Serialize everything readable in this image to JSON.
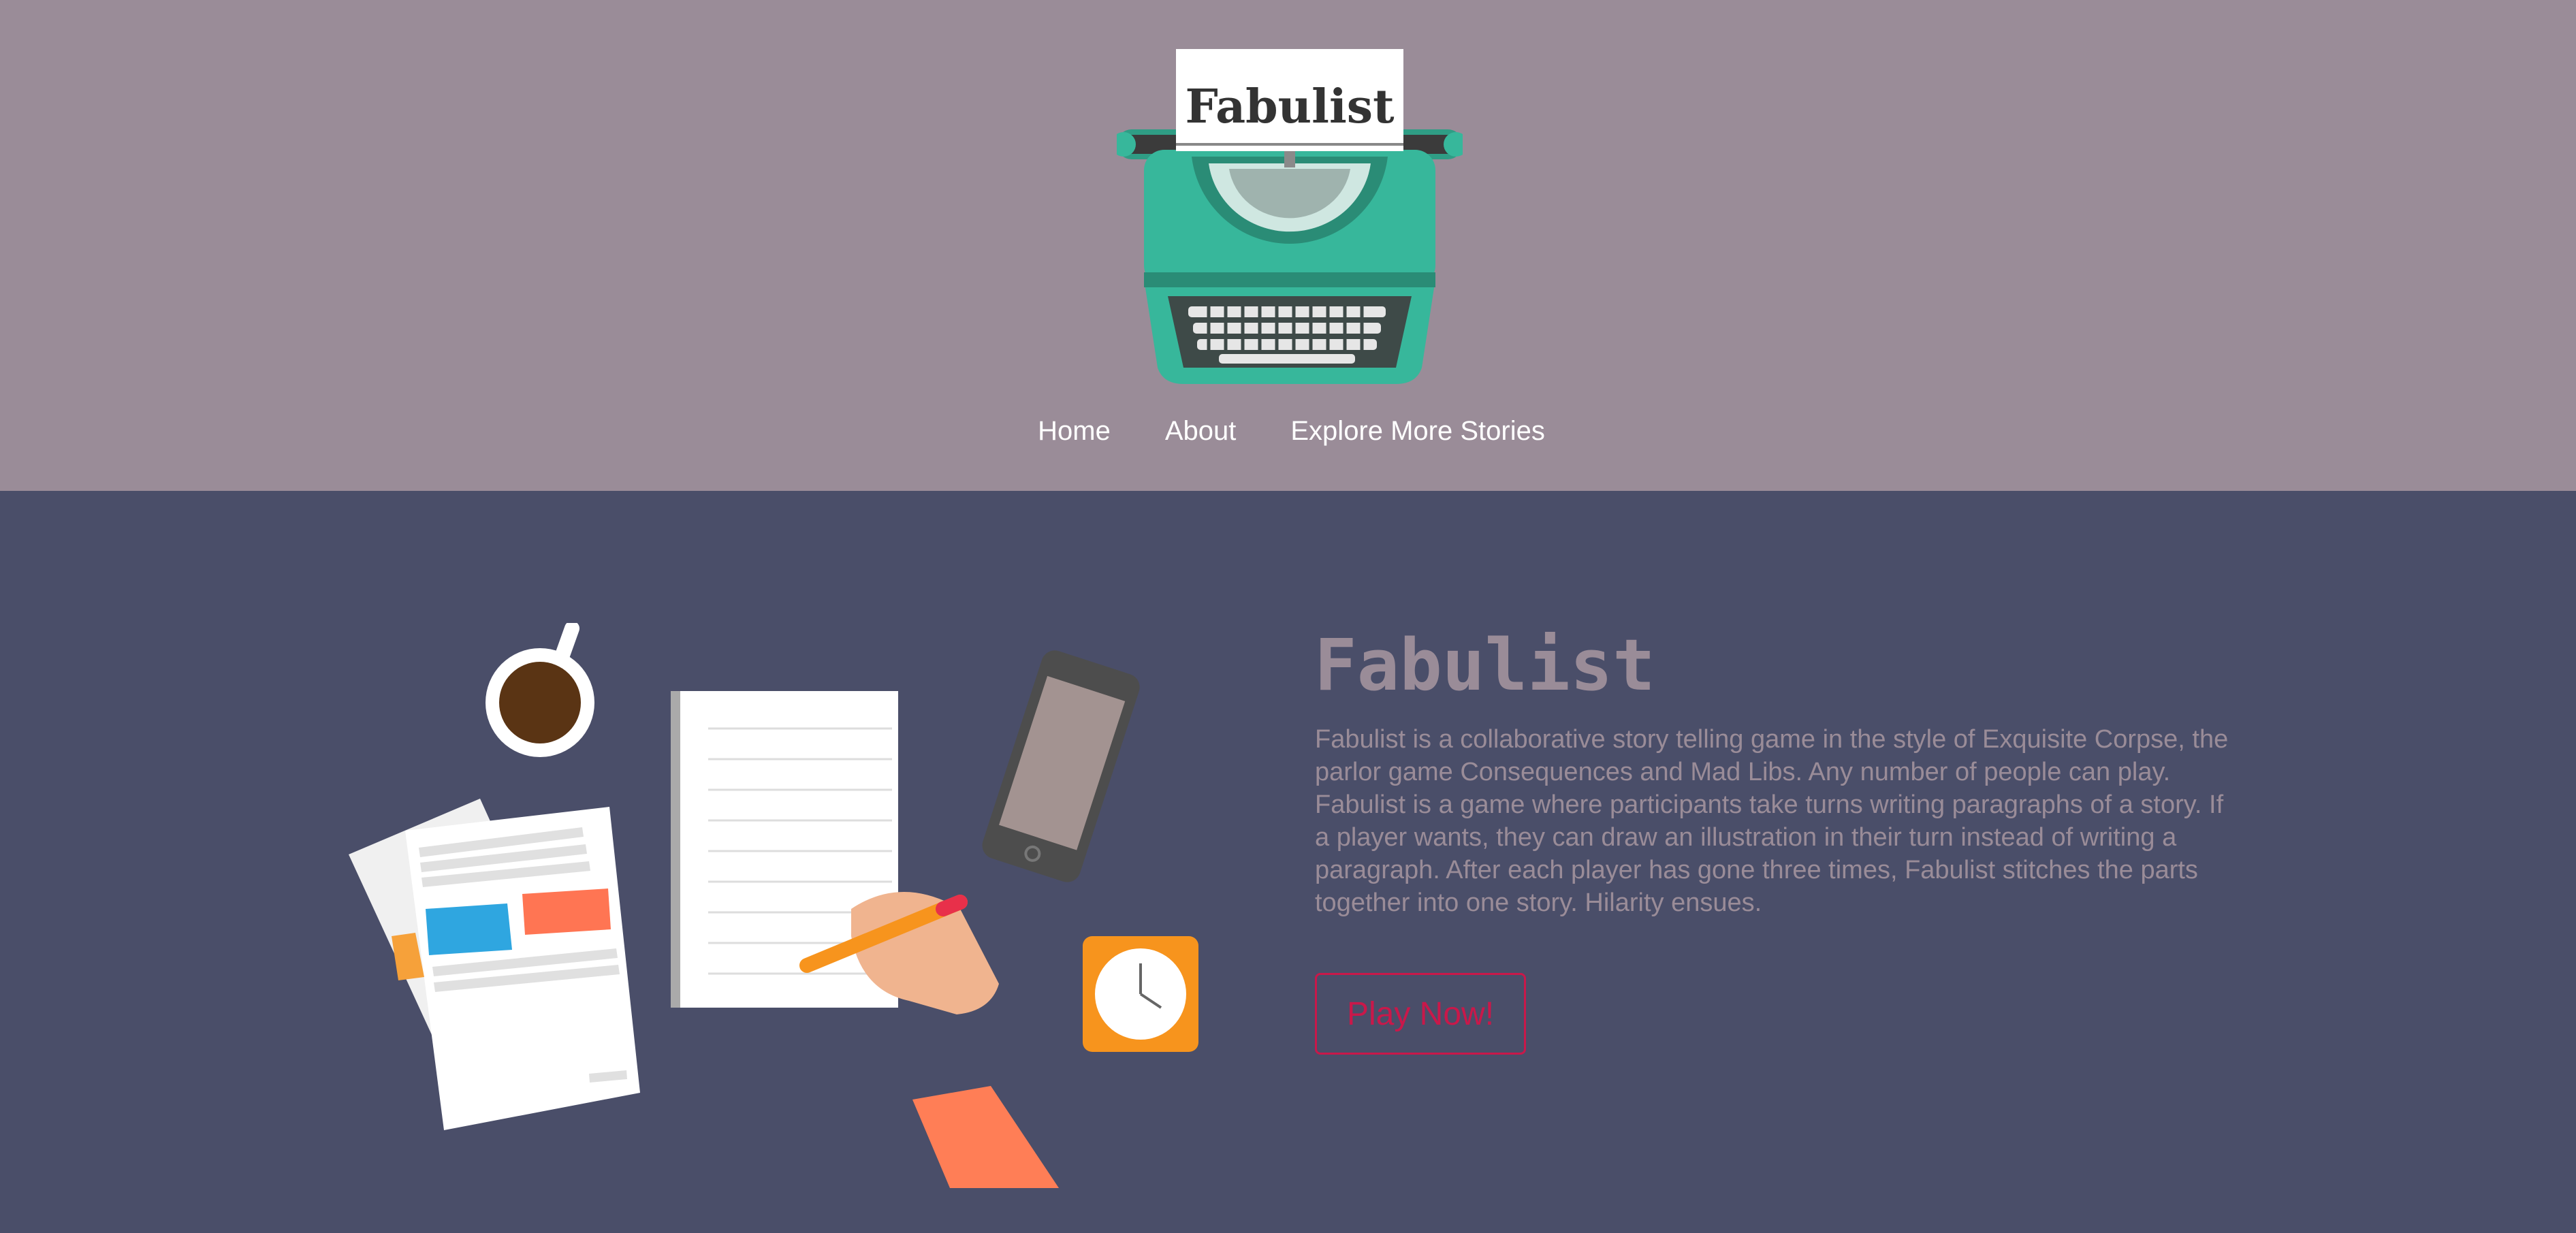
{
  "header": {
    "logo_text": "Fabulist",
    "nav": {
      "home": "Home",
      "about": "About",
      "explore": "Explore More Stories"
    }
  },
  "hero": {
    "title": "Fabulist",
    "description": "Fabulist is a collaborative story telling game in the style of Exquisite Corpse, the parlor game Consequences and Mad Libs. Any number of people can play. Fabulist is a game where participants take turns writing paragraphs of a story. If a player wants, they can draw an illustration in their turn instead of writing a paragraph. After each player has gone three times, Fabulist stitches the parts together into one story. Hilarity ensues.",
    "play_button": "Play Now!"
  },
  "colors": {
    "header_bg": "#9a8c98",
    "main_bg": "#4a4e69",
    "accent_red": "#c9184a",
    "text_muted": "#9a8c98",
    "typewriter_teal": "#37b79b"
  },
  "icons": {
    "logo": "typewriter-icon",
    "illustration": "desk-writing-illustration"
  }
}
